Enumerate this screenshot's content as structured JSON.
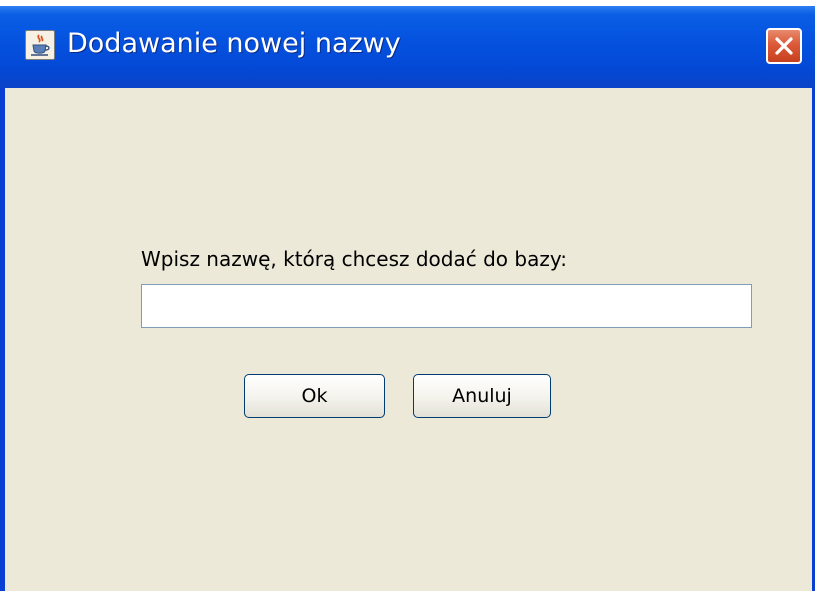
{
  "window": {
    "title": "Dodawanie nowej nazwy",
    "icon": "java-cup-icon",
    "close_icon": "close-icon",
    "colors": {
      "titlebar": "#0553e0",
      "body": "#ece9d8",
      "close_button": "#dc5a39"
    }
  },
  "form": {
    "prompt": "Wpisz nazwę, którą chcesz dodać do bazy:",
    "name_value": "",
    "ok_label": "Ok",
    "cancel_label": "Anuluj"
  }
}
